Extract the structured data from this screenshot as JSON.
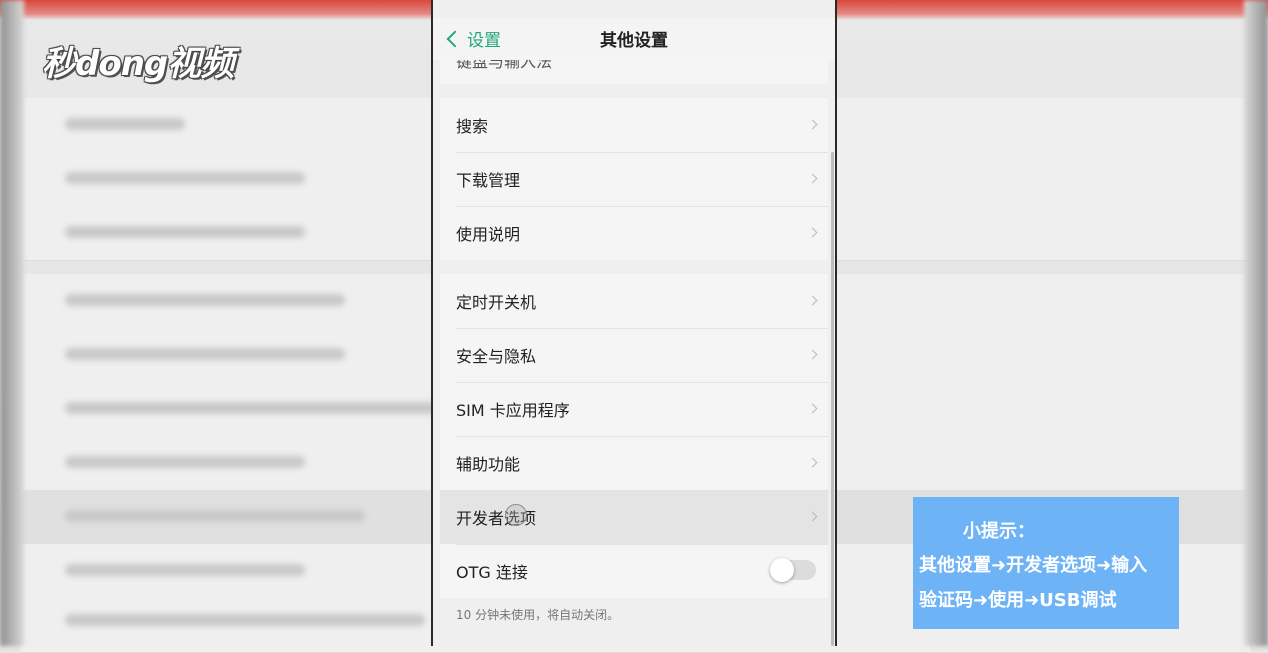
{
  "watermark": {
    "logo_text": "秒dong视频"
  },
  "header": {
    "back_label": "设置",
    "title": "其他设置"
  },
  "partial_item": "键盘与输入法",
  "group1": [
    "搜索",
    "下载管理",
    "使用说明"
  ],
  "group2": [
    "定时开关机",
    "安全与隐私",
    "SIM 卡应用程序",
    "辅助功能",
    "开发者选项"
  ],
  "otg": {
    "label": "OTG 连接",
    "enabled": false,
    "note": "10 分钟未使用，将自动关闭。"
  },
  "tip": {
    "title": "小提示：",
    "line1": "其他设置➜开发者选项➜输入",
    "line2": "验证码➜使用➜USB调试"
  },
  "colors": {
    "accent": "#24a87a",
    "tip_bg": "#6fb3f7",
    "top_bar": "#d9473b"
  }
}
